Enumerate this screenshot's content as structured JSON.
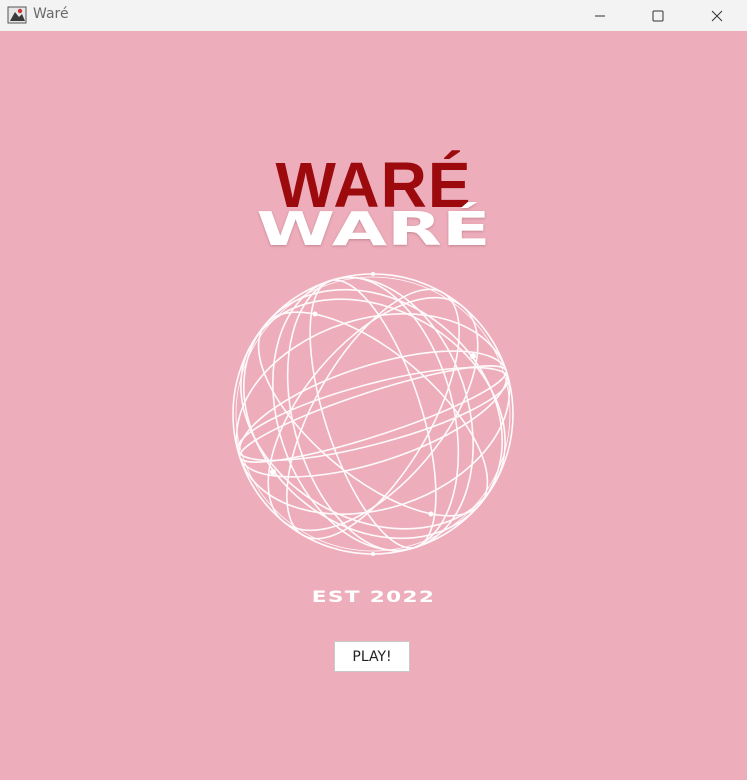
{
  "window": {
    "title": "Waré",
    "app_icon": "java-app-icon",
    "controls": {
      "minimize": "minimize-icon",
      "maximize": "maximize-icon",
      "close": "close-icon"
    }
  },
  "main": {
    "logo_text_red": "WARÉ",
    "logo_text_white": "WARÉ",
    "globe_graphic": "wireframe-globe-icon",
    "est_text": "EST 2022",
    "play_label": "PLAY!"
  },
  "colors": {
    "background": "#edadbb",
    "logo_red": "#9c0a0e",
    "logo_white": "#ffffff",
    "titlebar": "#f3f3f3"
  }
}
